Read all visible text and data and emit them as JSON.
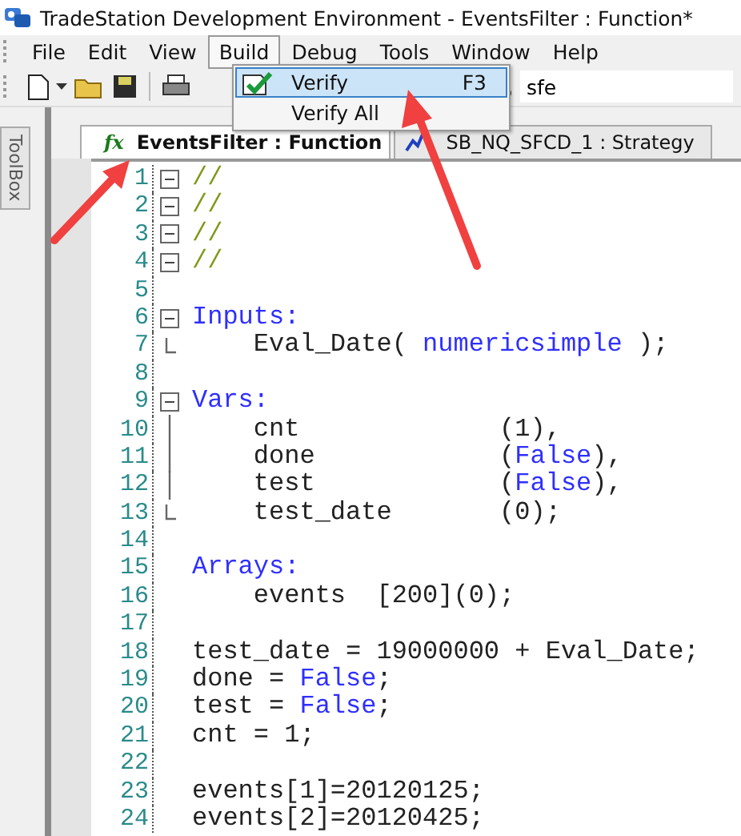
{
  "window": {
    "title": "TradeStation Development Environment - EventsFilter : Function*"
  },
  "menu_bar": [
    {
      "label": "File",
      "selected": false
    },
    {
      "label": "Edit",
      "selected": false
    },
    {
      "label": "View",
      "selected": false
    },
    {
      "label": "Build",
      "selected": true
    },
    {
      "label": "Debug",
      "selected": false
    },
    {
      "label": "Tools",
      "selected": false
    },
    {
      "label": "Window",
      "selected": false
    },
    {
      "label": "Help",
      "selected": false
    }
  ],
  "build_menu": [
    {
      "label": "Verify",
      "shortcut": "F3",
      "selected": true,
      "icon": true
    },
    {
      "label": "Verify All",
      "selected": false,
      "icon": false
    }
  ],
  "toolbar": {
    "search_value": "sfe"
  },
  "side_tab": {
    "label": "ToolBox"
  },
  "tabs": [
    {
      "label": "EventsFilter : Function",
      "icon": "fx",
      "selected": true,
      "kind": "function"
    },
    {
      "label": "SB_NQ_SFCD_1 : Strategy",
      "selected": false,
      "kind": "strategy"
    }
  ],
  "code_lines": [
    {
      "number": "1",
      "kind": "fold_open",
      "segments": [
        {
          "text": "//",
          "kind": "comment"
        }
      ]
    },
    {
      "number": "2",
      "kind": "fold_open",
      "segments": [
        {
          "text": "//",
          "kind": "comment"
        }
      ]
    },
    {
      "number": "3",
      "kind": "fold_open",
      "segments": [
        {
          "text": "//",
          "kind": "comment"
        }
      ]
    },
    {
      "number": "4",
      "kind": "fold_open",
      "segments": [
        {
          "text": "//",
          "kind": "comment"
        }
      ]
    },
    {
      "number": "5",
      "kind": "plain"
    },
    {
      "number": "6",
      "kind": "fold_open",
      "segments": [
        {
          "text": "Inputs:",
          "kind": "keyword"
        }
      ]
    },
    {
      "number": "7",
      "kind": "fold_end",
      "segments": [
        {
          "text": "    Eval_Date( ",
          "kind": "plain"
        },
        {
          "text": "numericsimple",
          "kind": "keyword"
        },
        {
          "text": " );",
          "kind": "plain"
        }
      ]
    },
    {
      "number": "8",
      "kind": "plain"
    },
    {
      "number": "9",
      "kind": "fold_open",
      "segments": [
        {
          "text": "Vars:",
          "kind": "keyword"
        }
      ]
    },
    {
      "number": "10",
      "kind": "fold_line",
      "segments": [
        {
          "text": "    cnt             (1),",
          "kind": "plain"
        }
      ]
    },
    {
      "number": "11",
      "kind": "fold_line",
      "segments": [
        {
          "text": "    done            (",
          "kind": "plain"
        },
        {
          "text": "False",
          "kind": "keyword"
        },
        {
          "text": "),",
          "kind": "plain"
        }
      ]
    },
    {
      "number": "12",
      "kind": "fold_line",
      "segments": [
        {
          "text": "    test            (",
          "kind": "plain"
        },
        {
          "text": "False",
          "kind": "keyword"
        },
        {
          "text": "),",
          "kind": "plain"
        }
      ]
    },
    {
      "number": "13",
      "kind": "fold_end",
      "segments": [
        {
          "text": "    test_date       (0);",
          "kind": "plain"
        }
      ]
    },
    {
      "number": "14",
      "kind": "plain"
    },
    {
      "number": "15",
      "kind": "plain",
      "segments": [
        {
          "text": "Arrays:",
          "kind": "keyword"
        }
      ]
    },
    {
      "number": "16",
      "kind": "plain",
      "segments": [
        {
          "text": "    events  [200](0);",
          "kind": "plain"
        }
      ]
    },
    {
      "number": "17",
      "kind": "plain"
    },
    {
      "number": "18",
      "kind": "plain",
      "segments": [
        {
          "text": "test_date = 19000000 + Eval_Date;",
          "kind": "plain"
        }
      ]
    },
    {
      "number": "19",
      "kind": "plain",
      "segments": [
        {
          "text": "done = ",
          "kind": "plain"
        },
        {
          "text": "False",
          "kind": "keyword"
        },
        {
          "text": ";",
          "kind": "plain"
        }
      ]
    },
    {
      "number": "20",
      "kind": "plain",
      "segments": [
        {
          "text": "test = ",
          "kind": "plain"
        },
        {
          "text": "False",
          "kind": "keyword"
        },
        {
          "text": ";",
          "kind": "plain"
        }
      ]
    },
    {
      "number": "21",
      "kind": "plain",
      "segments": [
        {
          "text": "cnt = 1;",
          "kind": "plain"
        }
      ]
    },
    {
      "number": "22",
      "kind": "plain"
    },
    {
      "number": "23",
      "kind": "plain",
      "segments": [
        {
          "text": "events[1]=20120125;",
          "kind": "plain"
        }
      ]
    },
    {
      "number": "24",
      "kind": "plain",
      "segments": [
        {
          "text": "events[2]=20120425;",
          "kind": "plain"
        }
      ]
    }
  ]
}
